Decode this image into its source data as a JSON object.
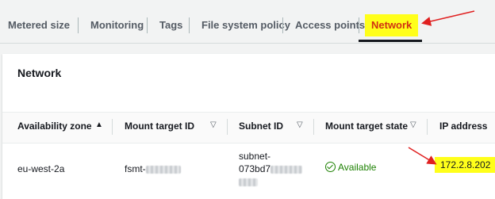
{
  "tabs": [
    {
      "label": "Metered size"
    },
    {
      "label": "Monitoring"
    },
    {
      "label": "Tags"
    },
    {
      "label": "File system policy"
    },
    {
      "label": "Access points"
    },
    {
      "label": "Network",
      "active": true
    }
  ],
  "panel": {
    "title": "Network"
  },
  "table": {
    "columns": [
      {
        "label": "Availability zone",
        "sort": "ascending"
      },
      {
        "label": "Mount target ID",
        "sort": "none"
      },
      {
        "label": "Subnet ID",
        "sort": "none"
      },
      {
        "label": "Mount target state",
        "sort": "none"
      },
      {
        "label": "IP address"
      }
    ],
    "rows": [
      {
        "availability_zone": "eu-west-2a",
        "mount_target_id": "fsmt-",
        "subnet_id_line1": "subnet-",
        "subnet_id_line2": "073bd7",
        "state": "Available",
        "ip_address": "172.2.8.202"
      }
    ]
  },
  "colors": {
    "highlight": "#ffff1a",
    "annotation_arrow": "#e02020",
    "status_green": "#1d8102"
  },
  "icons": {
    "sort_ascending": "triangle-up",
    "sort_none": "triangle-down-outline",
    "status": "check-circle"
  }
}
